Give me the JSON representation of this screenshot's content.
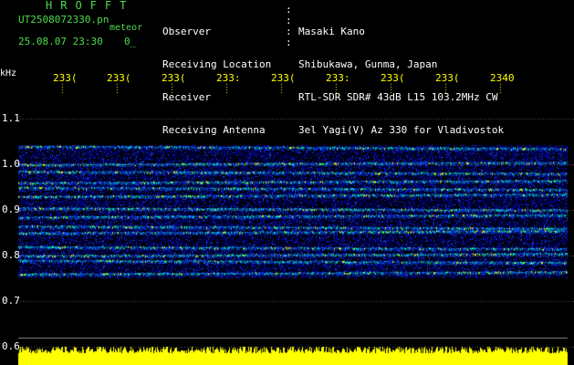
{
  "station": {
    "logo_text": "HROFFT",
    "filename": "UT2508072330.pn",
    "mode": "meteor",
    "datetime": "25.08.07 23:30",
    "count": "0_"
  },
  "header": {
    "rows": [
      {
        "label": "Observer",
        "value": "Masaki Kano"
      },
      {
        "label": "Receiving Location",
        "value": "Shibukawa, Gunma, Japan"
      },
      {
        "label": "Receiver",
        "value": "RTL-SDR SDR# 43dB L15 103.2MHz CW"
      },
      {
        "label": "Receiving Antenna",
        "value": "3el Yagi(V) Az 330 for Vladivostok"
      }
    ]
  },
  "chart_data": {
    "type": "heatmap",
    "ylabel": "kHz",
    "x_tick_labels": [
      "233(",
      "233(",
      "233(",
      "233:",
      "233(",
      "233:",
      "233(",
      "233(",
      "2340"
    ],
    "y_tick_labels": [
      "1.1",
      "1.0",
      "0.9",
      "0.8",
      "0.7",
      "0.6"
    ],
    "ylim": [
      0.6,
      1.15
    ],
    "echo_region_khz": [
      0.75,
      1.04
    ],
    "band_centers_khz": [
      1.04,
      1.0,
      0.985,
      0.96,
      0.95,
      0.93,
      0.905,
      0.885,
      0.865,
      0.85,
      0.82,
      0.8,
      0.79,
      0.76
    ],
    "grid": "horizontal dotted at 0.1 kHz",
    "colors": {
      "text": "#4cdc4c",
      "header_text": "#ffffff",
      "noise_bar": "#ffff00",
      "background": "#000000",
      "signal_low": "#0000c0",
      "signal_mid": "#00c0ff",
      "signal_high": "#ffff00"
    }
  }
}
